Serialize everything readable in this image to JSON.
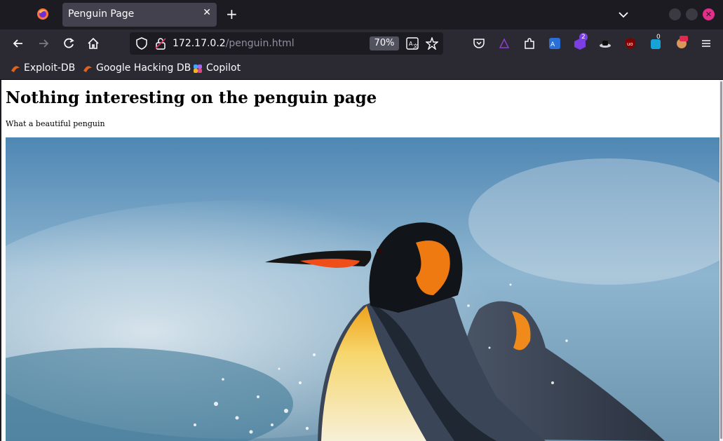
{
  "browser": {
    "tab": {
      "title": "Penguin Page",
      "close": "✕"
    },
    "new_tab": "+",
    "url": {
      "host": "172.17.0.2",
      "path": "/penguin.html"
    },
    "zoom": "70%",
    "extensions": {
      "badge_count_1": "2",
      "badge_count_2": "0"
    },
    "bookmarks": [
      "Exploit-DB",
      "Google Hacking DB",
      "Copilot"
    ]
  },
  "page": {
    "heading": "Nothing interesting on the penguin page",
    "caption": "What a beautiful penguin"
  }
}
